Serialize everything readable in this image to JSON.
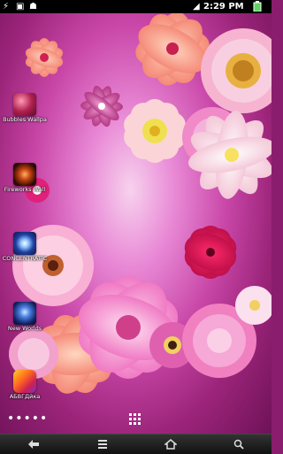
{
  "status_bar": {
    "time": "2:29 PM",
    "left_icons": [
      "usb-icon",
      "sd-card-icon",
      "android-debug-icon"
    ],
    "right_icons": [
      "wifi-icon",
      "battery-icon"
    ]
  },
  "desktop": {
    "apps": [
      {
        "label": "Bubbles Wallpa",
        "icon": "bubbles-app-icon",
        "color": "#7a1a40"
      },
      {
        "label": "Fireworks Wall",
        "icon": "fireworks-app-icon",
        "color": "#3a1a0a"
      },
      {
        "label": "CONCENTRATIC",
        "icon": "concentration-app-icon",
        "color": "#1a2a6a"
      },
      {
        "label": "New Worlds",
        "icon": "new-worlds-app-icon",
        "color": "#102060"
      },
      {
        "label": "АБВГДйка",
        "icon": "abvgdeika-app-icon",
        "color": "#d03020"
      }
    ],
    "page_indicator": "•••••"
  },
  "nav_bar": {
    "buttons": [
      "back-icon",
      "menu-icon",
      "home-icon",
      "search-icon"
    ]
  },
  "colors": {
    "status_bar_bg": "#000000",
    "nav_bar_bg": "#1a1a1a",
    "wallpaper_center": "#f7d2ee",
    "wallpaper_edge": "#6e1258"
  }
}
